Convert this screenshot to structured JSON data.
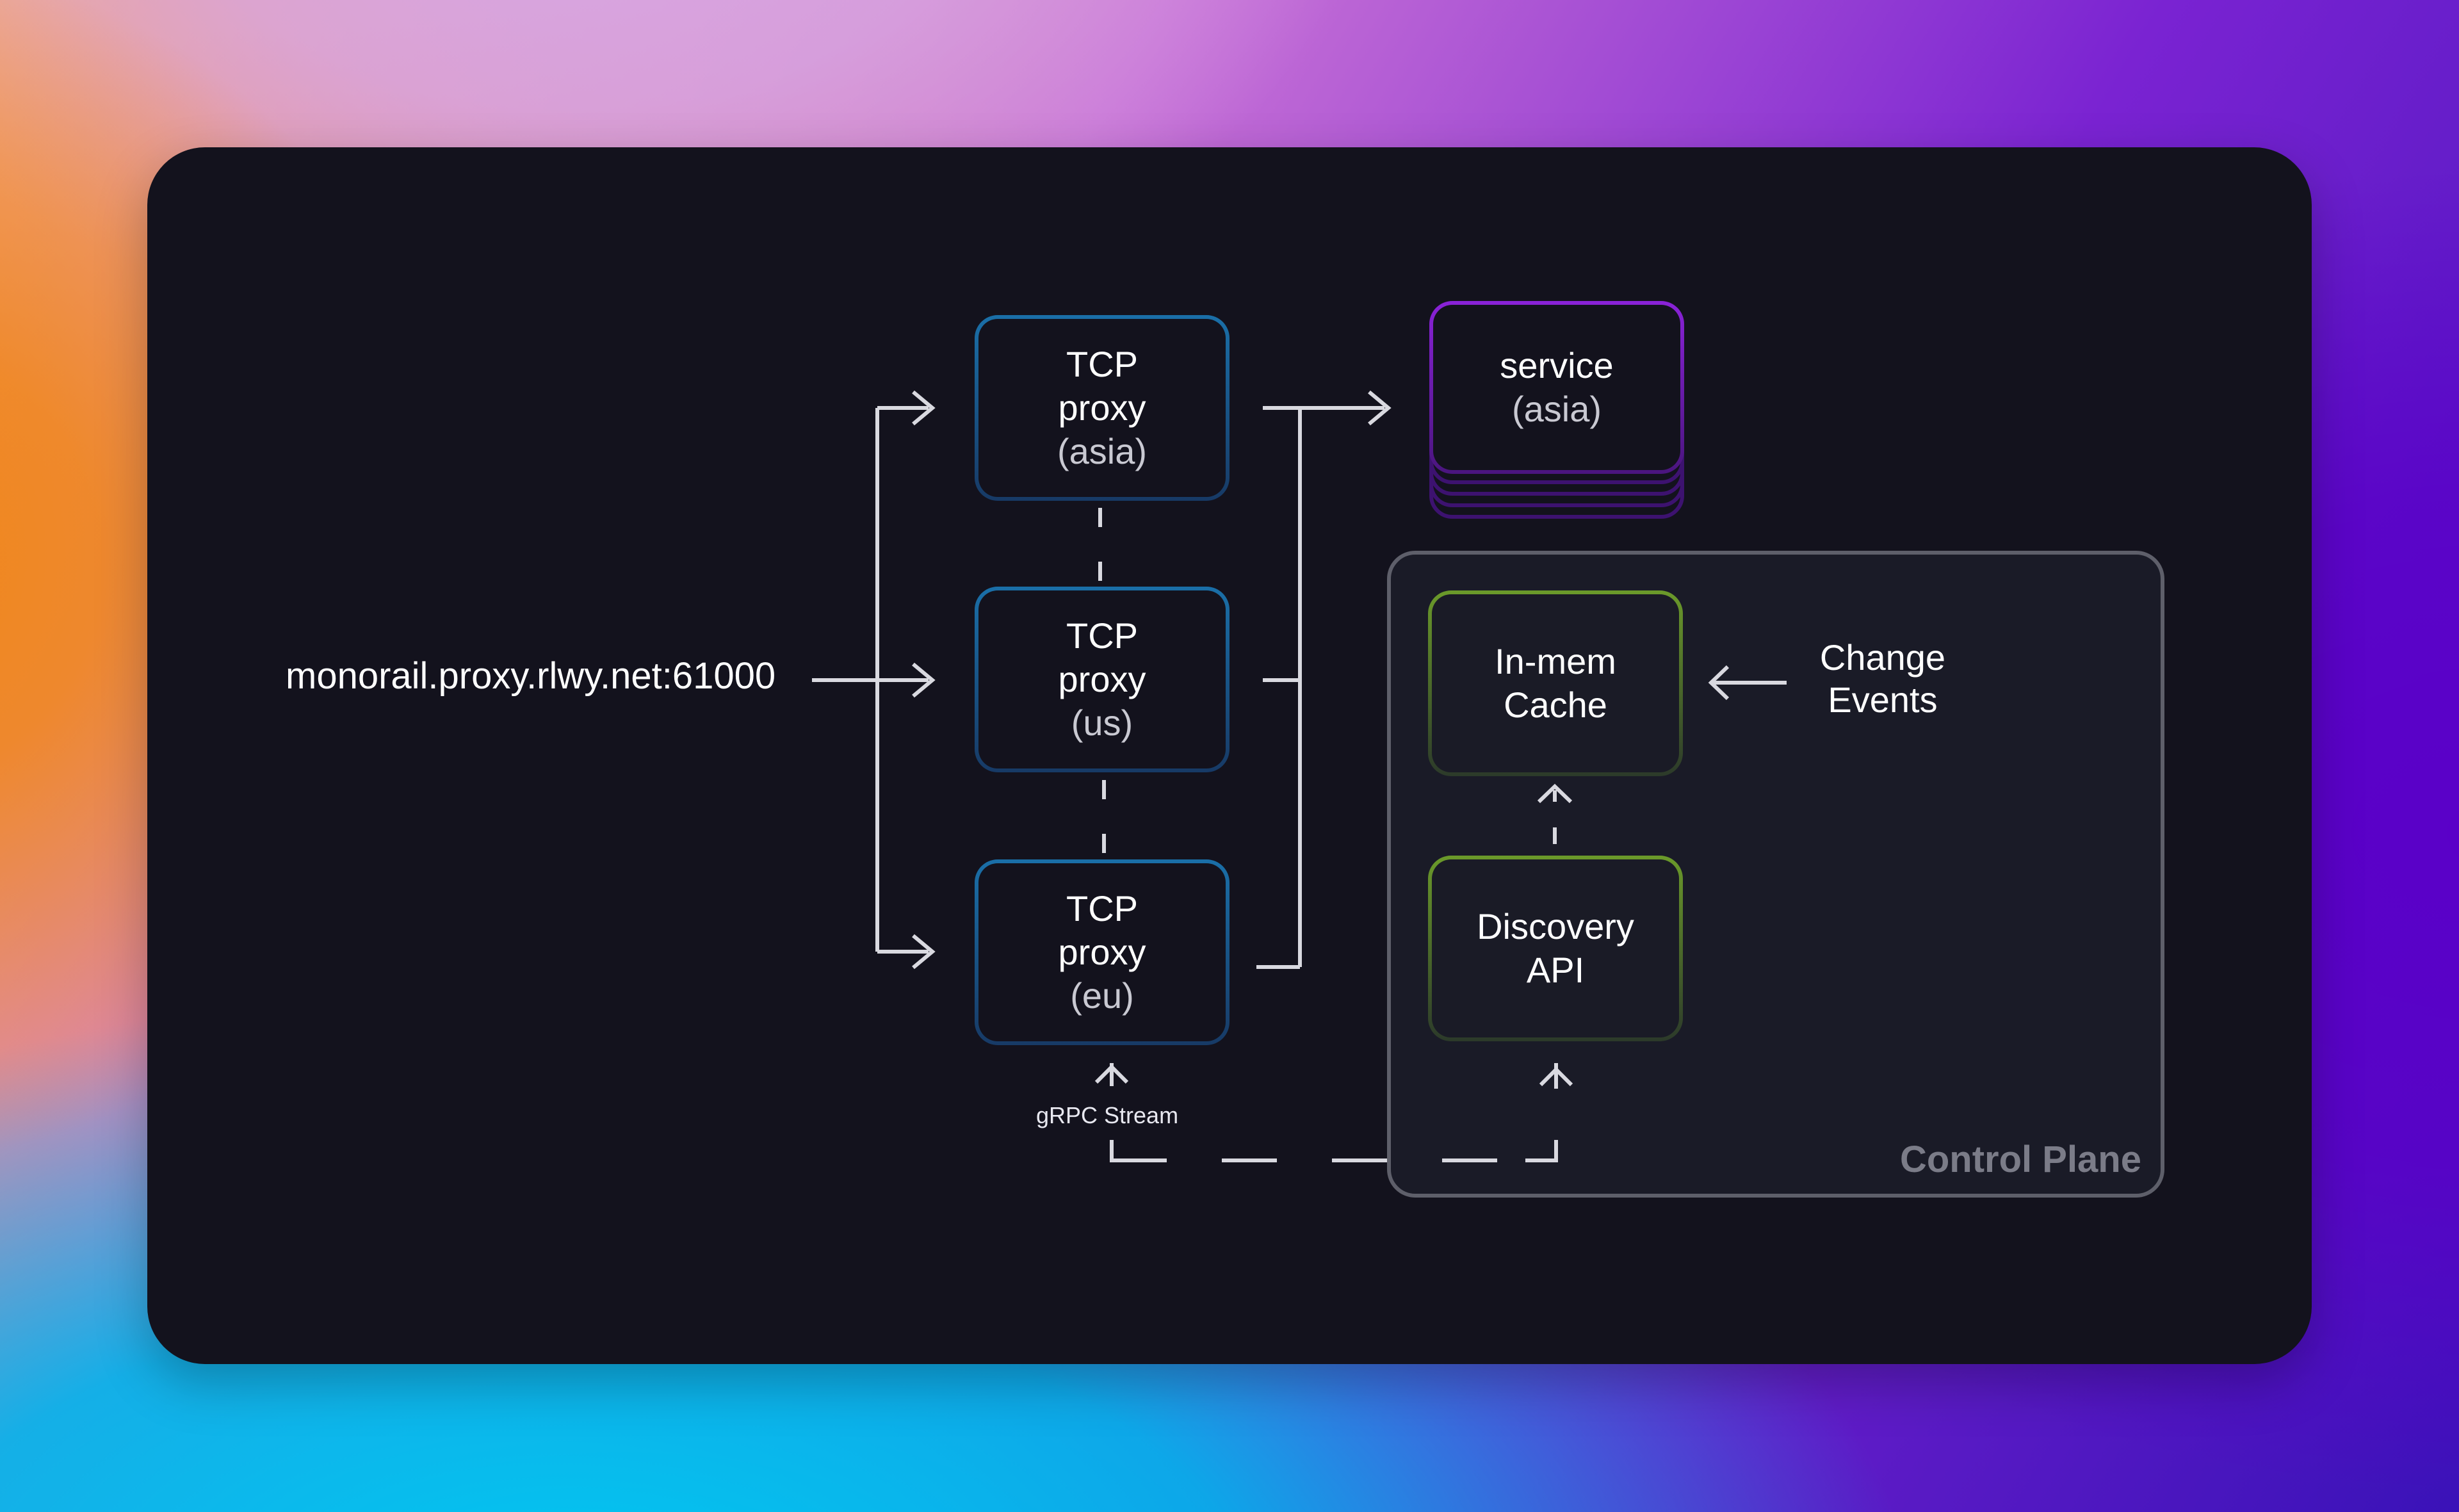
{
  "endpoint": "monorail.proxy.rlwy.net:61000",
  "proxies": [
    {
      "title": "TCP",
      "line2": "proxy",
      "region": "(asia)"
    },
    {
      "title": "TCP",
      "line2": "proxy",
      "region": "(us)"
    },
    {
      "title": "TCP",
      "line2": "proxy",
      "region": "(eu)"
    }
  ],
  "service": {
    "title": "service",
    "region": "(asia)"
  },
  "control_plane": {
    "label": "Control Plane",
    "cache": {
      "line1": "In-mem",
      "line2": "Cache"
    },
    "discovery": {
      "line1": "Discovery",
      "line2": "API"
    }
  },
  "change_events": {
    "line1": "Change",
    "line2": "Events"
  },
  "grpc_label": "gRPC Stream",
  "colors": {
    "canvas": "#13121d",
    "proxy_border": "#1a6fa8",
    "service_border": "#8a22d8",
    "green_border": "#6b9a2a",
    "control_plane_border": "#5e5f6a",
    "connector": "#d9d9e0"
  }
}
